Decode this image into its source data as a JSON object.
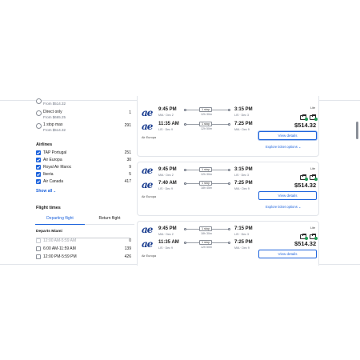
{
  "stops": {
    "partial_price": "From $514.32",
    "options": [
      {
        "label": "Direct only",
        "sub": "From $665.25",
        "count": "1"
      },
      {
        "label": "1 stop max",
        "sub": "From $514.32",
        "count": "291"
      }
    ]
  },
  "airlines": {
    "title": "Airlines",
    "items": [
      {
        "label": "TAP Portugal",
        "count": "251"
      },
      {
        "label": "Air Europa",
        "count": "30"
      },
      {
        "label": "Royal Air Maroc",
        "count": "9"
      },
      {
        "label": "Iberia",
        "count": "5"
      },
      {
        "label": "Air Canada",
        "count": "417"
      }
    ],
    "show_all": "Show all"
  },
  "flight_times": {
    "title": "Flight times",
    "tabs": [
      "Departing flight",
      "Return flight"
    ],
    "departs_label": "Departs Miami",
    "slots": [
      {
        "label": "12:00 AM-5:59 AM",
        "count": "0"
      },
      {
        "label": "6:00 AM-11:59 AM",
        "count": "139"
      },
      {
        "label": "12:00 PM-5:59 PM",
        "count": "426"
      }
    ]
  },
  "results": [
    {
      "logo": "ae",
      "airline": "Air Europa",
      "fare": "Lite",
      "price": "$514.32",
      "view": "View details",
      "explore": "Explore ticket options",
      "legs": [
        {
          "dep": "9:45 PM",
          "dep_sub": "MIA · Dec 2",
          "stops": "1 stop",
          "dur": "12h 30m",
          "arr": "3:15 PM",
          "arr_sub": "LIS · Dec 3"
        },
        {
          "dep": "11:35 AM",
          "dep_sub": "LIS · Dec 9",
          "stops": "1 stop",
          "dur": "12h 50m",
          "arr": "7:25 PM",
          "arr_sub": "MIA · Dec 9"
        }
      ]
    },
    {
      "logo": "ae",
      "airline": "Air Europa",
      "fare": "Lite",
      "price": "$514.32",
      "view": "View details",
      "explore": "Explore ticket options",
      "legs": [
        {
          "dep": "9:45 PM",
          "dep_sub": "MIA · Dec 2",
          "stops": "1 stop",
          "dur": "12h 30m",
          "arr": "3:15 PM",
          "arr_sub": "LIS · Dec 3"
        },
        {
          "dep": "7:40 AM",
          "dep_sub": "LIS · Dec 9",
          "stops": "1 stop",
          "dur": "18h 45m",
          "arr": "7:25 PM",
          "arr_sub": "MIA · Dec 9"
        }
      ]
    },
    {
      "logo": "ae",
      "airline": "Air Europa",
      "fare": "Lite",
      "price": "$514.32",
      "view": "View details",
      "explore": "",
      "legs": [
        {
          "dep": "9:45 PM",
          "dep_sub": "MIA · Dec 2",
          "stops": "1 stop",
          "dur": "18h 30m",
          "arr": "7:15 PM",
          "arr_sub": "LIS · Dec 3"
        },
        {
          "dep": "11:35 AM",
          "dep_sub": "LIS · Dec 9",
          "stops": "1 stop",
          "dur": "12h 50m",
          "arr": "7:25 PM",
          "arr_sub": "MIA · Dec 9"
        }
      ]
    }
  ],
  "colors": {
    "accent": "#1d63dc",
    "bag_ok": "#1f9d55",
    "logo": "#1a3d8f"
  },
  "icons": [
    "bag-icon",
    "check-icon",
    "chevron-down-icon",
    "radio-icon",
    "checkbox-icon"
  ]
}
